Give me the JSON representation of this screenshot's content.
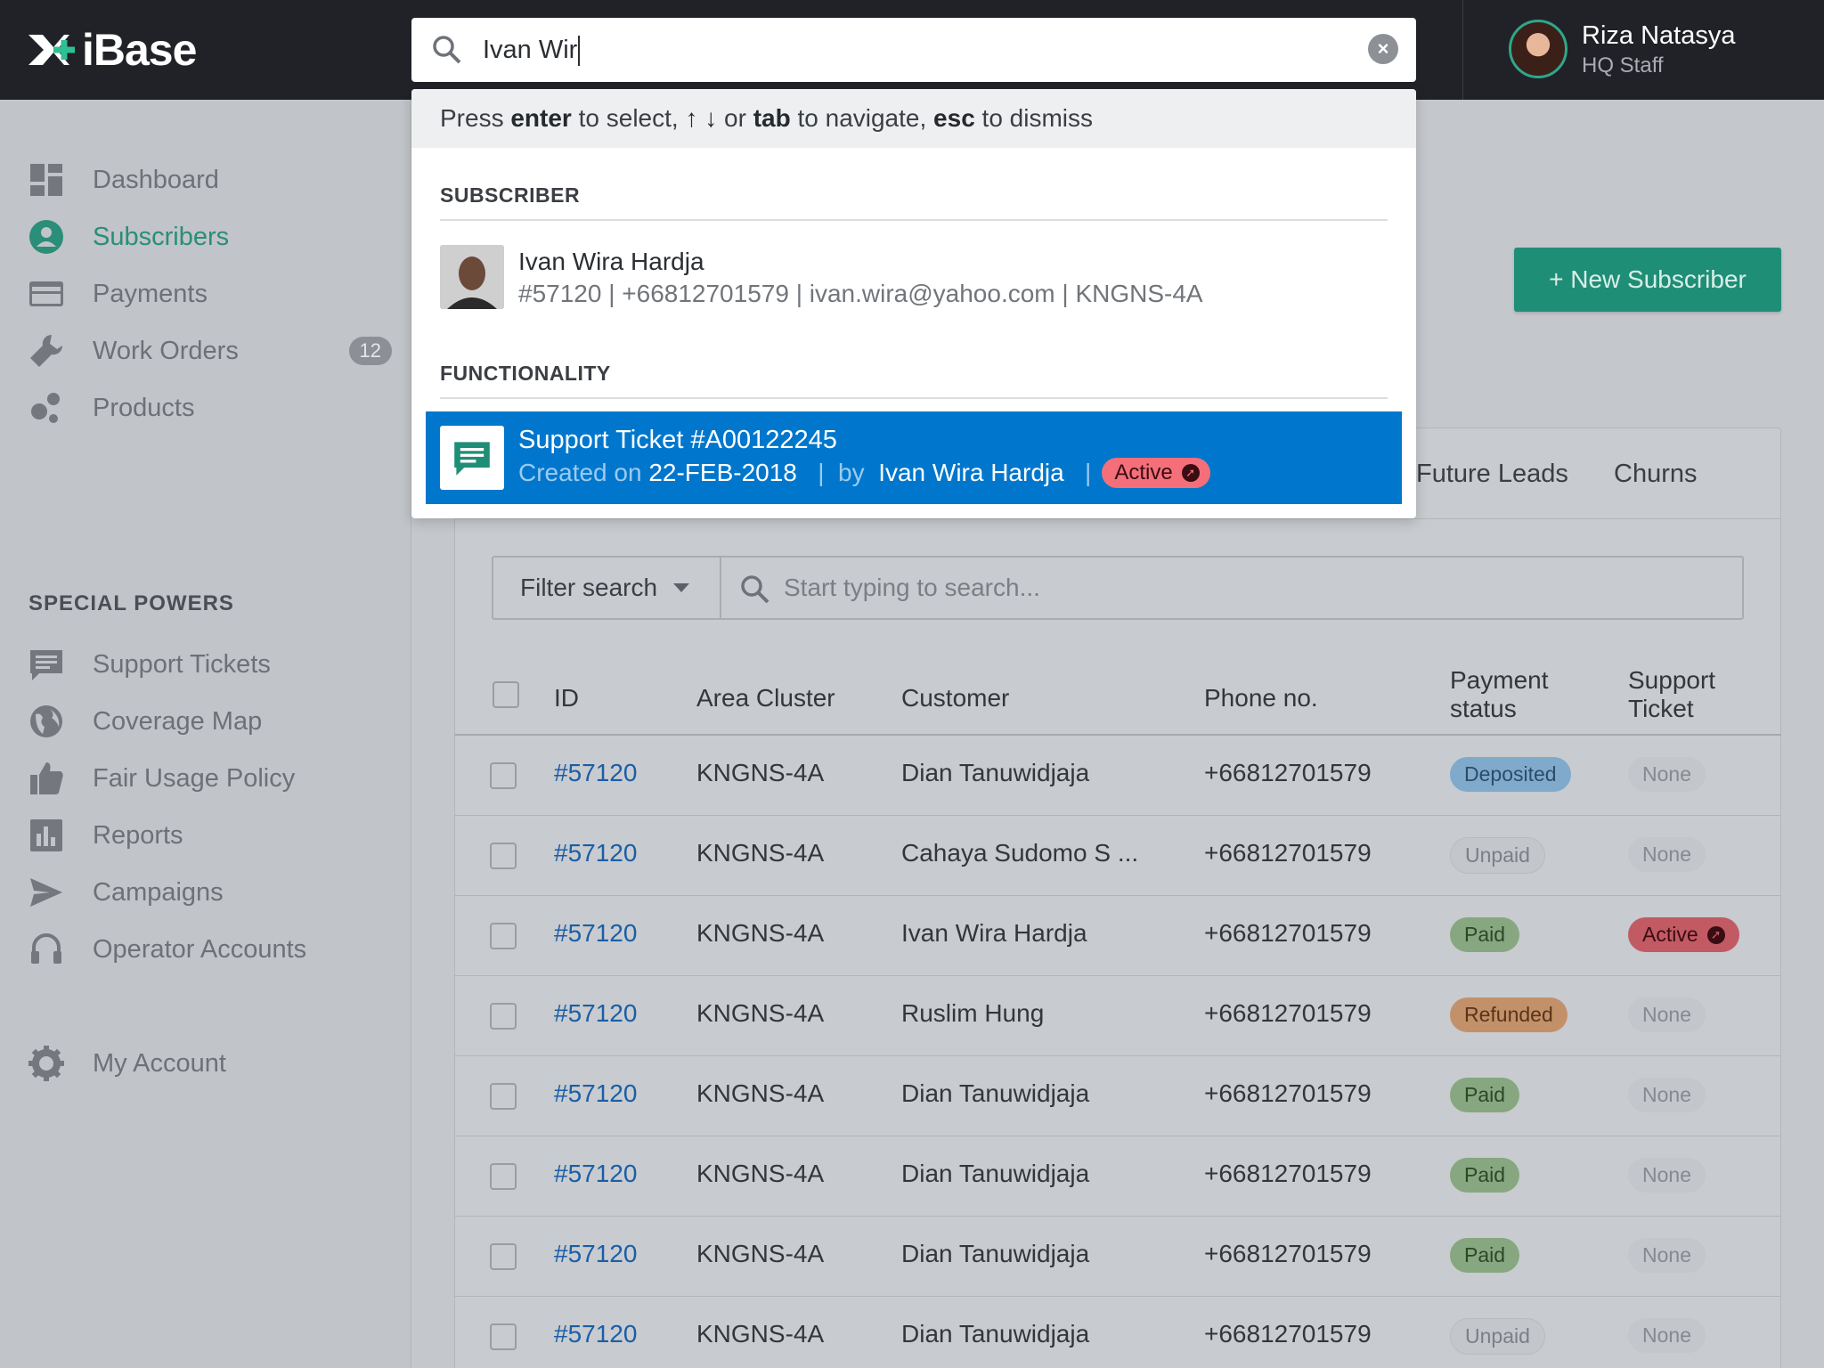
{
  "app": {
    "name": "iBase"
  },
  "user": {
    "name": "Riza Natasya",
    "role": "HQ Staff"
  },
  "sidebar": {
    "items": [
      {
        "label": "Dashboard",
        "icon": "dashboard-icon"
      },
      {
        "label": "Subscribers",
        "icon": "user-circle-icon",
        "active": true
      },
      {
        "label": "Payments",
        "icon": "credit-card-icon"
      },
      {
        "label": "Work Orders",
        "icon": "wrench-icon",
        "badge": "12"
      },
      {
        "label": "Products",
        "icon": "products-icon"
      }
    ],
    "section_title": "SPECIAL POWERS",
    "powers": [
      {
        "label": "Support Tickets",
        "icon": "chat-icon"
      },
      {
        "label": "Coverage Map",
        "icon": "globe-icon"
      },
      {
        "label": "Fair Usage Policy",
        "icon": "thumbs-up-icon"
      },
      {
        "label": "Reports",
        "icon": "bar-chart-icon"
      },
      {
        "label": "Campaigns",
        "icon": "send-icon"
      },
      {
        "label": "Operator Accounts",
        "icon": "headset-icon"
      }
    ],
    "account": {
      "label": "My Account",
      "icon": "gear-icon"
    }
  },
  "search": {
    "value": "Ivan Wir",
    "hint": {
      "press": "Press ",
      "enter": "enter",
      "to_select": " to select, ",
      "arrows": "↑ ↓",
      "or": " or ",
      "tab": "tab",
      "to_navigate": " to navigate, ",
      "esc": "esc",
      "to_dismiss": " to dismiss"
    },
    "groups": {
      "subscriber": "SUBSCRIBER",
      "functionality": "FUNCTIONALITY"
    },
    "subscriber_result": {
      "name": "Ivan Wira Hardja",
      "meta": "#57120  |  +66812701579  |  ivan.wira@yahoo.com  |  KNGNS-4A"
    },
    "ticket_result": {
      "title": "Support Ticket #A00122245",
      "created_on": "Created on ",
      "date": "22-FEB-2018",
      "by": "  |  by ",
      "author": "Ivan Wira Hardja",
      "sep": "  |",
      "status": "Active"
    }
  },
  "main": {
    "new_button": "+ New Subscriber",
    "tabs": {
      "future": "Future Leads",
      "churns": "Churns"
    },
    "filter_label": "Filter search",
    "search_placeholder": "Start typing to search...",
    "columns": {
      "id": "ID",
      "area": "Area Cluster",
      "customer": "Customer",
      "phone": "Phone no.",
      "payment_1": "Payment",
      "payment_2": "status",
      "support_1": "Support",
      "support_2": "Ticket"
    },
    "rows": [
      {
        "id": "#57120",
        "area": "KNGNS-4A",
        "customer": "Dian Tanuwidjaja",
        "phone": "+66812701579",
        "payment": "Deposited",
        "ticket": "None"
      },
      {
        "id": "#57120",
        "area": "KNGNS-4A",
        "customer": "Cahaya Sudomo S ...",
        "phone": "+66812701579",
        "payment": "Unpaid",
        "ticket": "None"
      },
      {
        "id": "#57120",
        "area": "KNGNS-4A",
        "customer": "Ivan Wira Hardja",
        "phone": "+66812701579",
        "payment": "Paid",
        "ticket": "Active"
      },
      {
        "id": "#57120",
        "area": "KNGNS-4A",
        "customer": "Ruslim Hung",
        "phone": "+66812701579",
        "payment": "Refunded",
        "ticket": "None"
      },
      {
        "id": "#57120",
        "area": "KNGNS-4A",
        "customer": "Dian Tanuwidjaja",
        "phone": "+66812701579",
        "payment": "Paid",
        "ticket": "None"
      },
      {
        "id": "#57120",
        "area": "KNGNS-4A",
        "customer": "Dian Tanuwidjaja",
        "phone": "+66812701579",
        "payment": "Paid",
        "ticket": "None"
      },
      {
        "id": "#57120",
        "area": "KNGNS-4A",
        "customer": "Dian Tanuwidjaja",
        "phone": "+66812701579",
        "payment": "Paid",
        "ticket": "None"
      },
      {
        "id": "#57120",
        "area": "KNGNS-4A",
        "customer": "Dian Tanuwidjaja",
        "phone": "+66812701579",
        "payment": "Unpaid",
        "ticket": "None"
      }
    ]
  },
  "colors": {
    "accent_green": "#2a8e78",
    "selection_blue": "#0077cc",
    "topbar": "#212227",
    "active_red": "#f46f7a"
  }
}
